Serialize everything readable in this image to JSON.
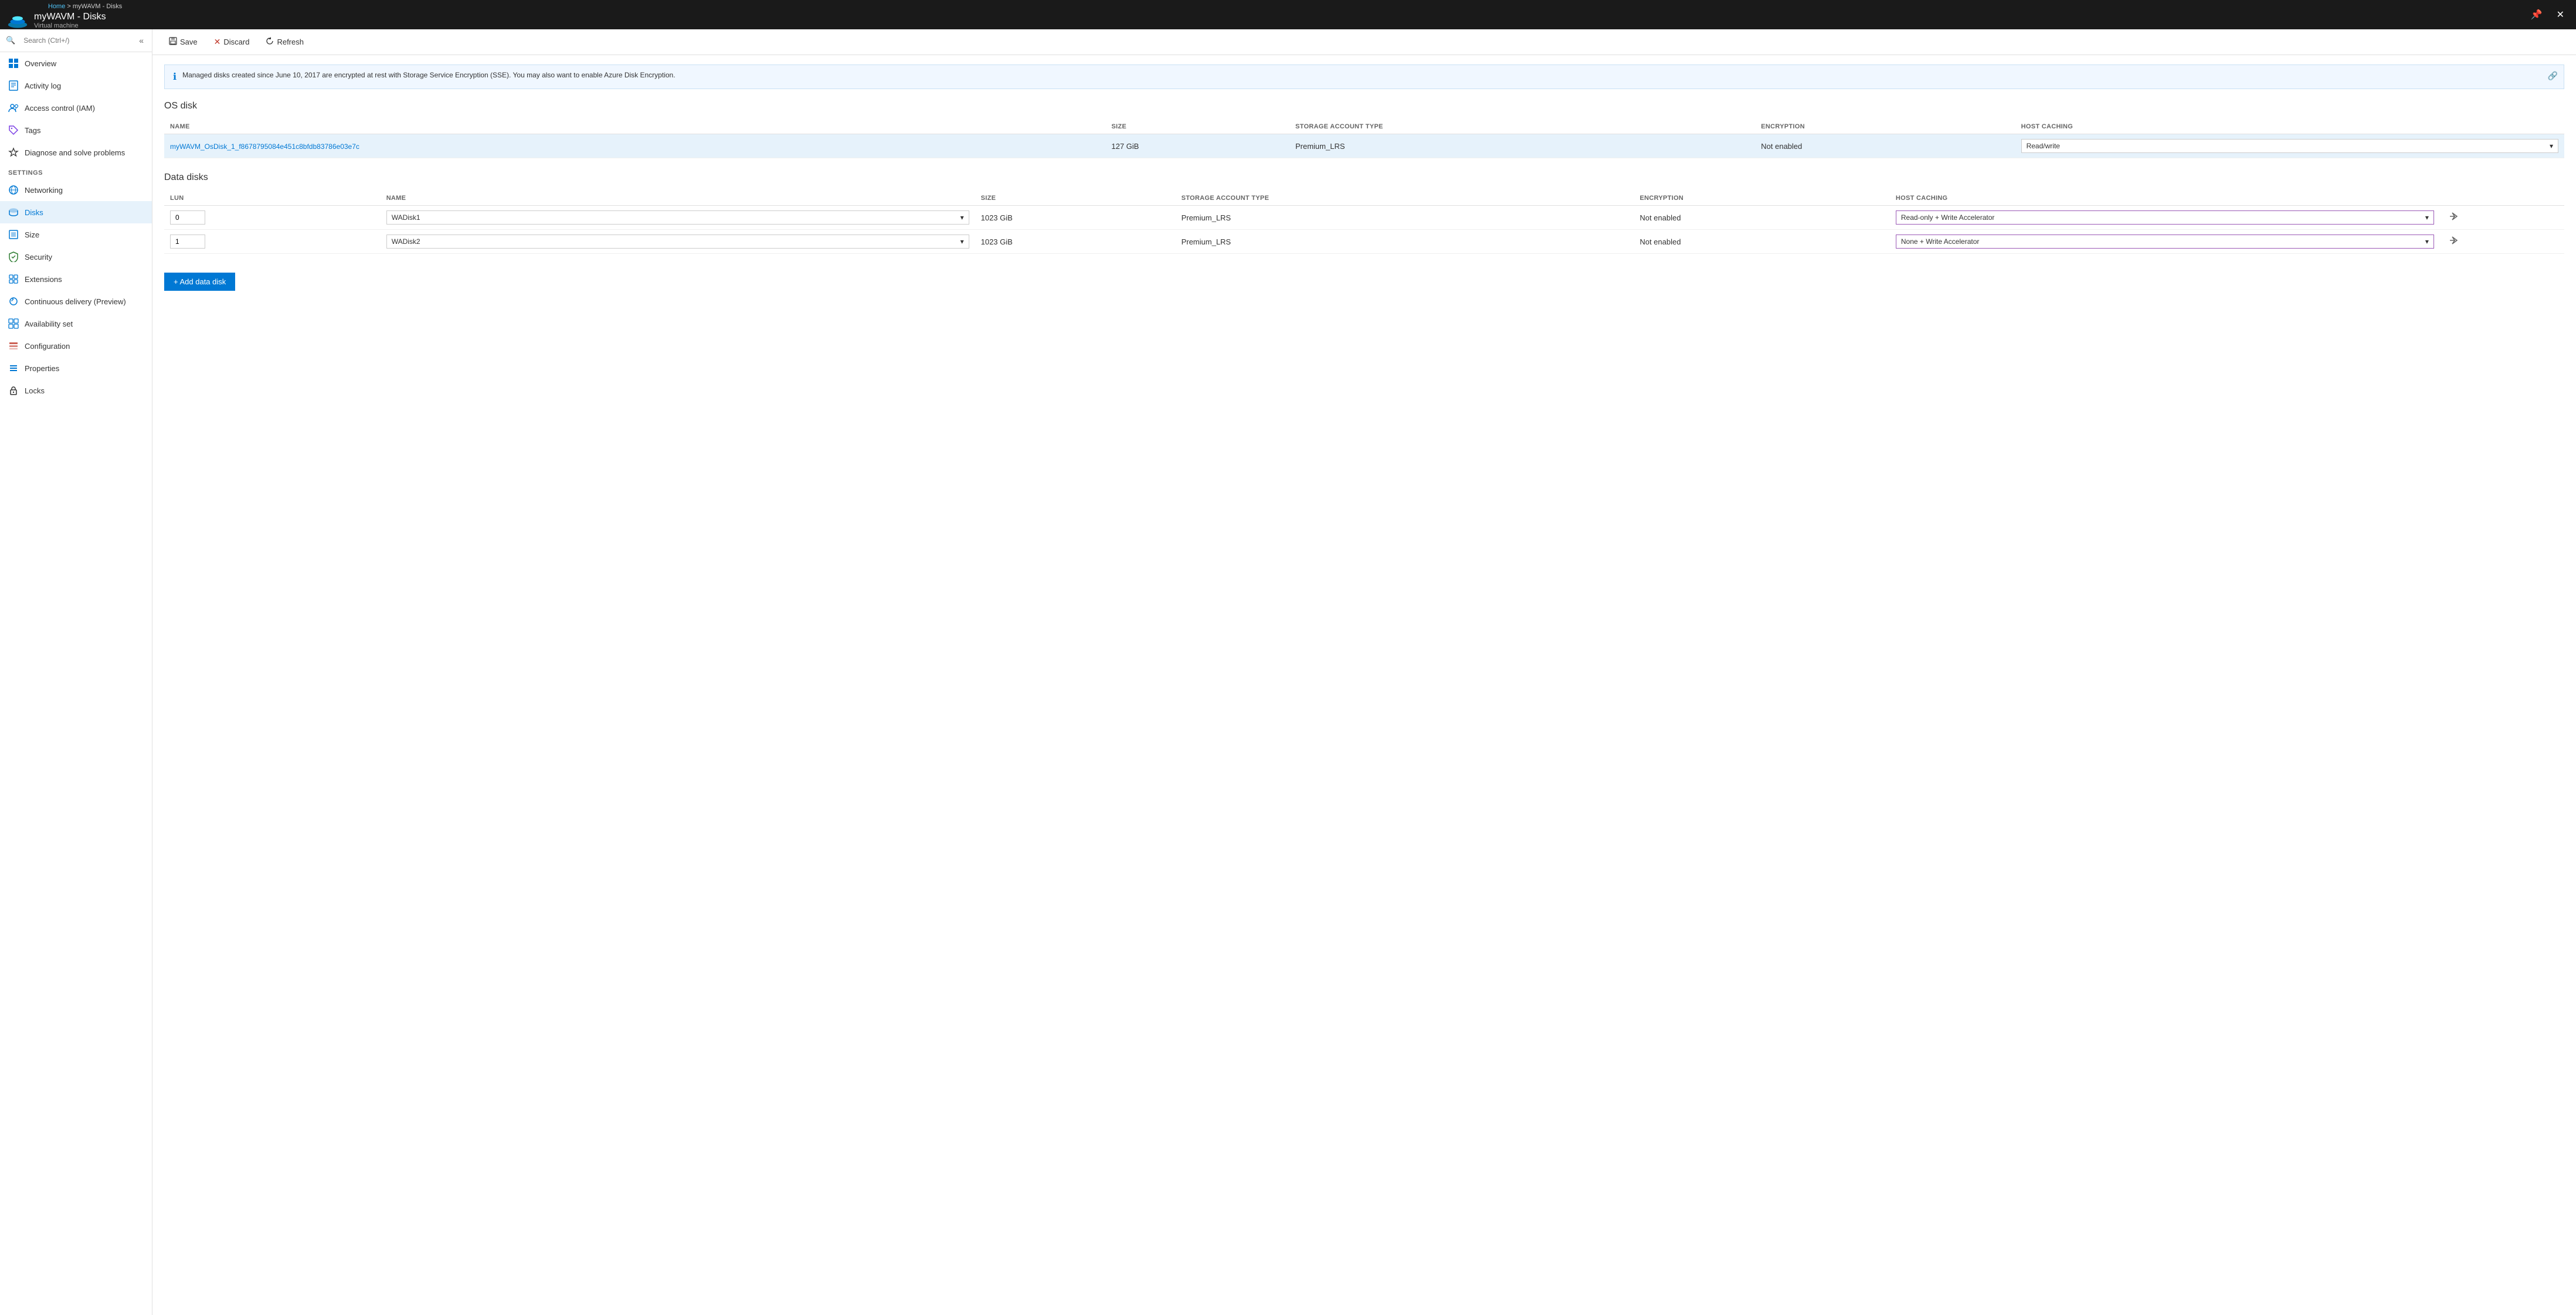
{
  "topbar": {
    "breadcrumb_home": "Home",
    "breadcrumb_separator": " > ",
    "breadcrumb_current": "myWAVM - Disks",
    "title": "myWAVM - Disks",
    "subtitle": "Virtual machine",
    "pin_icon": "📌",
    "close_icon": "✕"
  },
  "sidebar": {
    "search_placeholder": "Search (Ctrl+/)",
    "collapse_icon": "«",
    "items": [
      {
        "id": "overview",
        "label": "Overview",
        "icon": "⬜",
        "icon_color": "#0078d4"
      },
      {
        "id": "activity-log",
        "label": "Activity log",
        "icon": "📋",
        "icon_color": "#0078d4"
      },
      {
        "id": "access-control",
        "label": "Access control (IAM)",
        "icon": "👥",
        "icon_color": "#0078d4"
      },
      {
        "id": "tags",
        "label": "Tags",
        "icon": "🏷",
        "icon_color": "#7b3fe4"
      },
      {
        "id": "diagnose",
        "label": "Diagnose and solve problems",
        "icon": "🔧",
        "icon_color": "#333"
      }
    ],
    "settings_label": "SETTINGS",
    "settings_items": [
      {
        "id": "networking",
        "label": "Networking",
        "icon": "🌐",
        "icon_color": "#0078d4"
      },
      {
        "id": "disks",
        "label": "Disks",
        "icon": "💾",
        "icon_color": "#0078d4",
        "active": true
      },
      {
        "id": "size",
        "label": "Size",
        "icon": "⬜",
        "icon_color": "#0078d4"
      },
      {
        "id": "security",
        "label": "Security",
        "icon": "🛡",
        "icon_color": "#2e7d32"
      },
      {
        "id": "extensions",
        "label": "Extensions",
        "icon": "🧩",
        "icon_color": "#0078d4"
      },
      {
        "id": "continuous-delivery",
        "label": "Continuous delivery (Preview)",
        "icon": "🔄",
        "icon_color": "#0078d4"
      },
      {
        "id": "availability-set",
        "label": "Availability set",
        "icon": "⊞",
        "icon_color": "#0078d4"
      },
      {
        "id": "configuration",
        "label": "Configuration",
        "icon": "🗂",
        "icon_color": "#c0392b"
      },
      {
        "id": "properties",
        "label": "Properties",
        "icon": "≡",
        "icon_color": "#0078d4"
      },
      {
        "id": "locks",
        "label": "Locks",
        "icon": "🔒",
        "icon_color": "#333"
      }
    ]
  },
  "toolbar": {
    "save_label": "Save",
    "discard_label": "Discard",
    "refresh_label": "Refresh"
  },
  "info_banner": {
    "text": "Managed disks created since June 10, 2017 are encrypted at rest with Storage Service Encryption (SSE). You may also want to enable Azure Disk Encryption."
  },
  "os_disk": {
    "section_title": "OS disk",
    "columns": [
      "NAME",
      "SIZE",
      "STORAGE ACCOUNT TYPE",
      "ENCRYPTION",
      "HOST CACHING"
    ],
    "row": {
      "name": "myWAVM_OsDisk_1_f8678795084e451c8bfdb83786e03e7c",
      "size": "127 GiB",
      "storage_account_type": "Premium_LRS",
      "encryption": "Not enabled",
      "host_caching": "Read/write"
    }
  },
  "data_disks": {
    "section_title": "Data disks",
    "columns": [
      "LUN",
      "NAME",
      "SIZE",
      "STORAGE ACCOUNT TYPE",
      "ENCRYPTION",
      "HOST CACHING"
    ],
    "rows": [
      {
        "lun": "0",
        "name": "WADisk1",
        "size": "1023 GiB",
        "storage_account_type": "Premium_LRS",
        "encryption": "Not enabled",
        "host_caching": "Read-only + Write Accelerator"
      },
      {
        "lun": "1",
        "name": "WADisk2",
        "size": "1023 GiB",
        "storage_account_type": "Premium_LRS",
        "encryption": "Not enabled",
        "host_caching": "None + Write Accelerator"
      }
    ]
  },
  "add_disk_btn": "+ Add data disk"
}
